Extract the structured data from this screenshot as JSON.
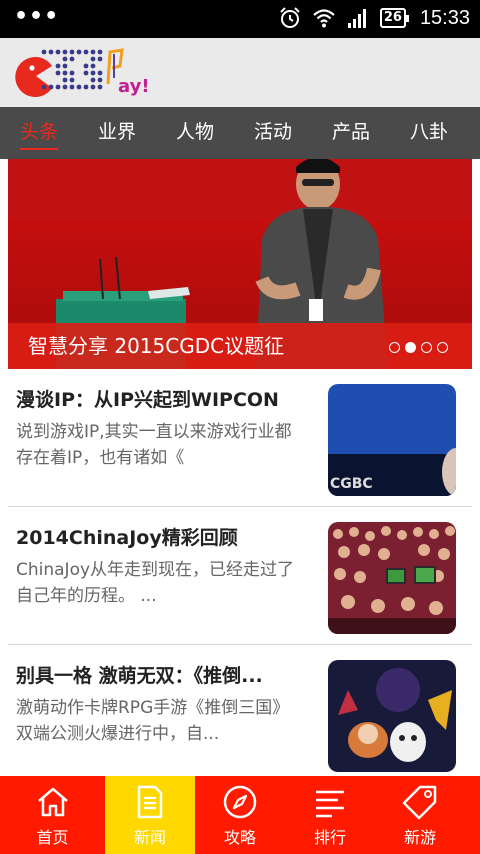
{
  "status_bar": {
    "battery": "26",
    "time": "15:33"
  },
  "logo_text": "Play!",
  "nav_tabs": [
    {
      "label": "头条",
      "active": true
    },
    {
      "label": "业界",
      "active": false
    },
    {
      "label": "人物",
      "active": false
    },
    {
      "label": "活动",
      "active": false
    },
    {
      "label": "产品",
      "active": false
    },
    {
      "label": "八卦",
      "active": false
    }
  ],
  "banner": {
    "caption": "智慧分享  2015CGDC议题征",
    "slide_count": 4,
    "active_slide": 1
  },
  "news": [
    {
      "title": "漫谈IP：从IP兴起到WIPCON",
      "summary": "        说到游戏IP,其实一直以来游戏行业都存在着IP，也有诸如《"
    },
    {
      "title": " 2014ChinaJoy精彩回顾",
      "summary": "ChinaJoy从年走到现在，已经走过了自己年的历程。 ..."
    },
    {
      "title": "别具一格 激萌无双：《推倒...",
      "summary": "激萌动作卡牌RPG手游《推倒三国》双端公测火爆进行中，自..."
    }
  ],
  "bottom_nav": [
    {
      "label": "首页",
      "icon": "home-icon",
      "active": false
    },
    {
      "label": "新闻",
      "icon": "news-document-icon",
      "active": true
    },
    {
      "label": "攻略",
      "icon": "compass-icon",
      "active": false
    },
    {
      "label": "排行",
      "icon": "ranking-list-icon",
      "active": false
    },
    {
      "label": "新游",
      "icon": "tag-icon",
      "active": false
    }
  ],
  "colors": {
    "brand_red": "#e8291d",
    "bottom_nav_bg": "#ff1a00",
    "bottom_nav_active": "#ffd800",
    "tab_bar_bg": "#4a4a4a"
  }
}
